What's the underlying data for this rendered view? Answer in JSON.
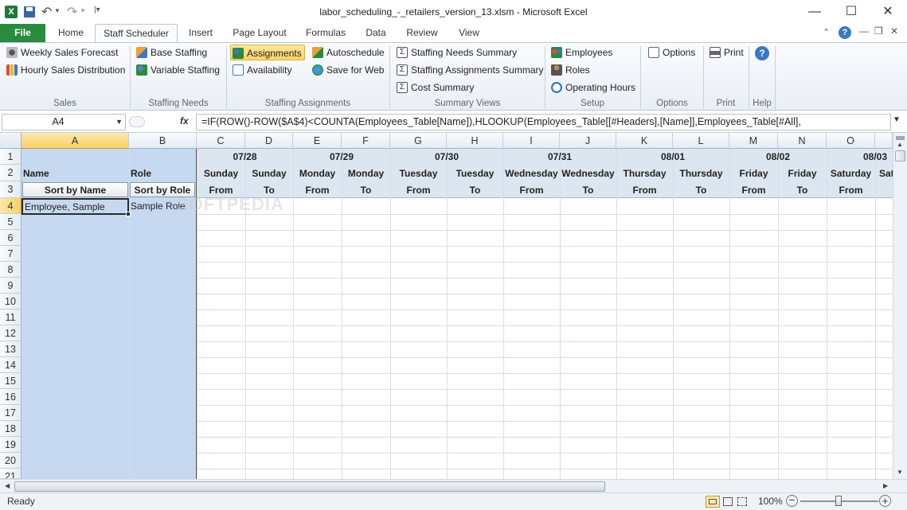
{
  "window": {
    "title": "labor_scheduling_-_retailers_version_13.xlsm - Microsoft Excel",
    "minimize": "—",
    "maximize": "☐",
    "close": "✕"
  },
  "tabs": [
    {
      "label": "File"
    },
    {
      "label": "Home"
    },
    {
      "label": "Staff Scheduler"
    },
    {
      "label": "Insert"
    },
    {
      "label": "Page Layout"
    },
    {
      "label": "Formulas"
    },
    {
      "label": "Data"
    },
    {
      "label": "Review"
    },
    {
      "label": "View"
    }
  ],
  "ribbon": {
    "sales": {
      "label": "Sales",
      "items": [
        "Weekly Sales Forecast",
        "Hourly Sales Distribution"
      ]
    },
    "staffing_needs": {
      "label": "Staffing Needs",
      "items": [
        "Base Staffing",
        "Variable Staffing"
      ]
    },
    "staffing_assignments": {
      "label": "Staffing Assignments",
      "items": [
        "Assignments",
        "Autoschedule",
        "Availability",
        "Save for Web"
      ]
    },
    "summary_views": {
      "label": "Summary Views",
      "items": [
        "Staffing Needs Summary",
        "Staffing Assignments Summary",
        "Cost Summary"
      ]
    },
    "setup": {
      "label": "Setup",
      "items": [
        "Employees",
        "Roles",
        "Operating Hours"
      ]
    },
    "options": {
      "label": "Options",
      "item": "Options"
    },
    "print": {
      "label": "Print",
      "item": "Print"
    },
    "help": {
      "label": "Help",
      "item": "?"
    }
  },
  "formula_bar": {
    "name_box": "A4",
    "fx": "fx",
    "formula": "=IF(ROW()-ROW($A$4)<COUNTA(Employees_Table[Name]),HLOOKUP(Employees_Table[[#Headers],[Name]],Employees_Table[#All],"
  },
  "columns": [
    "A",
    "B",
    "C",
    "D",
    "E",
    "F",
    "G",
    "H",
    "I",
    "J",
    "K",
    "L",
    "M",
    "N",
    "O"
  ],
  "rows": [
    "1",
    "2",
    "3",
    "4",
    "5",
    "6",
    "7",
    "8",
    "9",
    "10",
    "11",
    "12",
    "13",
    "14",
    "15",
    "16",
    "17",
    "18",
    "19",
    "20",
    "21"
  ],
  "sheet": {
    "dates": [
      "07/28",
      "07/29",
      "07/30",
      "07/31",
      "08/01",
      "08/02",
      "08/03"
    ],
    "days": [
      "Sunday",
      "Sunday",
      "Monday",
      "Monday",
      "Tuesday",
      "Tuesday",
      "Wednesday",
      "Wednesday",
      "Thursday",
      "Thursday",
      "Friday",
      "Friday",
      "Saturday",
      "Sat"
    ],
    "from_to": [
      "From",
      "To",
      "From",
      "To",
      "From",
      "To",
      "From",
      "To",
      "From",
      "To",
      "From",
      "To",
      "From"
    ],
    "name_header": "Name",
    "role_header": "Role",
    "sort_by_name": "Sort by Name",
    "sort_by_role": "Sort by Role",
    "employee": "Employee, Sample",
    "role": "Sample Role",
    "watermark": "SOFTPEDIA"
  },
  "status": {
    "ready": "Ready",
    "zoom": "100%"
  },
  "colors": {
    "file_tab": "#2a8b3e",
    "selected_cell_border": "#2b2b2b",
    "frozen_pane": "#c6d9f1",
    "header_blue": "#dce6f1"
  }
}
